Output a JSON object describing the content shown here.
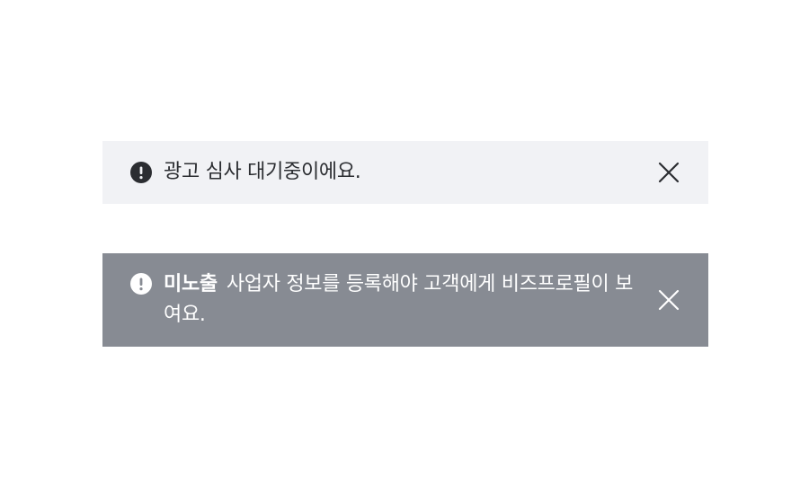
{
  "banners": [
    {
      "variant": "pending",
      "icon": "exclamation-circle-icon",
      "message": "광고 심사 대기중이에요.",
      "close_icon": "close-icon",
      "colors": {
        "background": "#f1f2f5",
        "text": "#2b2d31",
        "icon": "#2b2d31"
      }
    },
    {
      "variant": "hidden",
      "icon": "exclamation-circle-icon",
      "status_label": "미노출",
      "message": "사업자 정보를 등록해야 고객에게 비즈프로필이 보여요.",
      "close_icon": "close-icon",
      "colors": {
        "background": "#878b93",
        "text": "#ffffff",
        "icon": "#ffffff"
      }
    }
  ]
}
